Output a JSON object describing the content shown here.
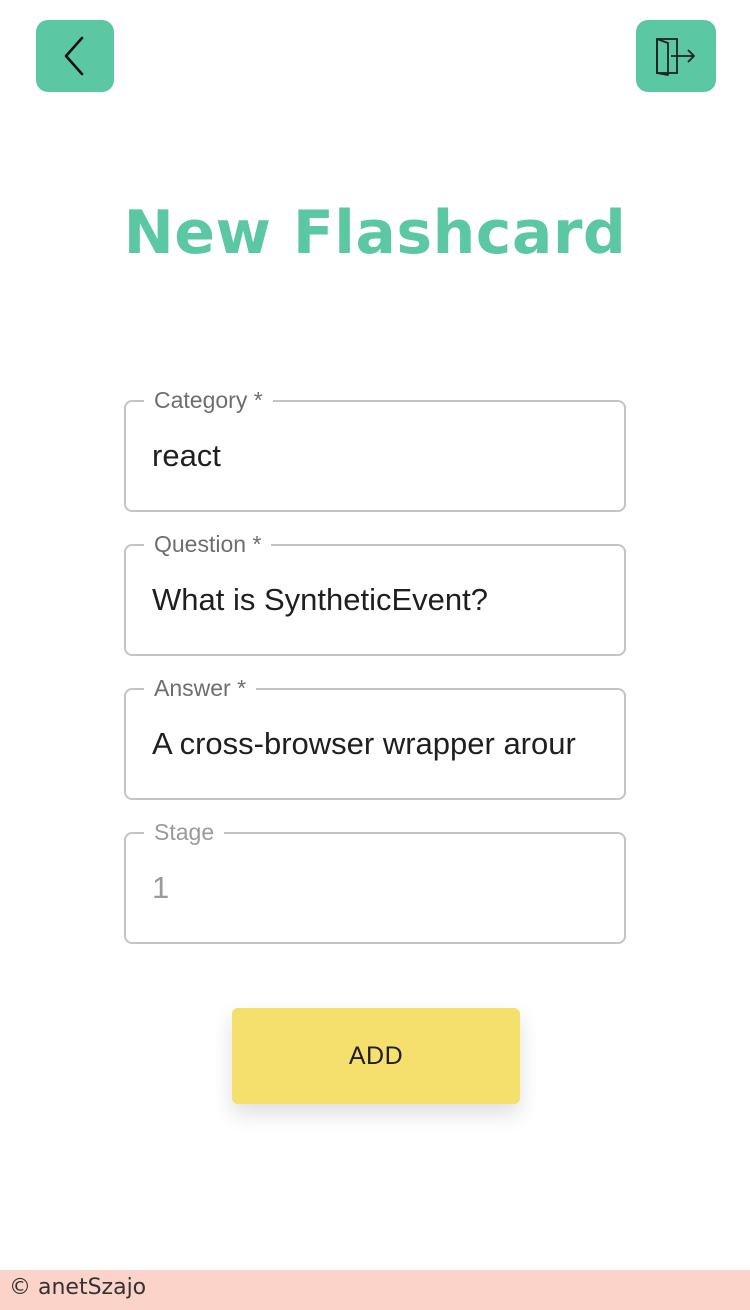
{
  "header": {
    "back_icon": "chevron-left-icon",
    "logout_icon": "door-exit-icon"
  },
  "title": "New Flashcard",
  "form": {
    "category": {
      "label": "Category *",
      "value": "react"
    },
    "question": {
      "label": "Question *",
      "value": "What is SyntheticEvent?"
    },
    "answer": {
      "label": "Answer *",
      "value": "A cross-browser wrapper arour"
    },
    "stage": {
      "label": "Stage",
      "value": "1"
    }
  },
  "add_button": {
    "label": "ADD"
  },
  "footer": {
    "text": "© anetSzajo"
  },
  "colors": {
    "accent": "#5bc7a3",
    "button": "#f6e06d",
    "footer": "#fbd3c9"
  }
}
